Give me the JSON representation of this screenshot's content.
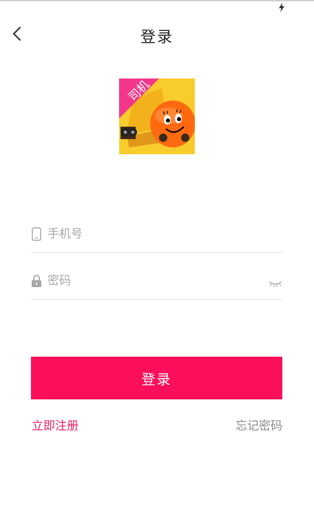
{
  "nav": {
    "title": "登录"
  },
  "logo": {
    "badge_text": "司机"
  },
  "form": {
    "phone_placeholder": "手机号",
    "password_placeholder": "密码",
    "login_label": "登录"
  },
  "links": {
    "register": "立即注册",
    "forgot": "忘记密码"
  },
  "colors": {
    "accent": "#fb0f5a",
    "link": "#e91e63"
  },
  "icons": {
    "back": "chevron-left-icon",
    "phone": "phone-icon",
    "lock": "lock-icon",
    "eye": "eye-closed-icon",
    "status": "bolt-icon"
  }
}
